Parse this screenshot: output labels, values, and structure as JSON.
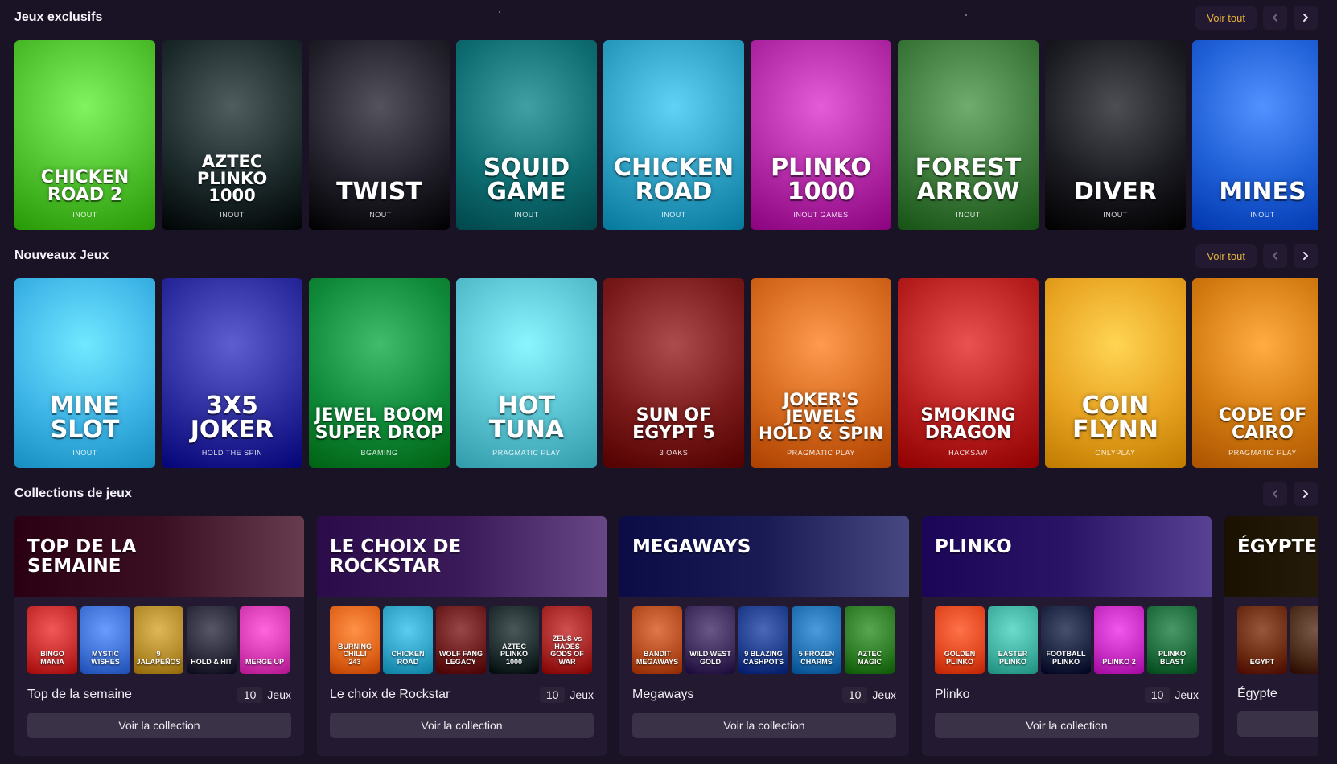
{
  "sections": {
    "exclusive": {
      "title": "Jeux exclusifs",
      "see_all": "Voir tout"
    },
    "new": {
      "title": "Nouveaux Jeux",
      "see_all": "Voir tout"
    },
    "collections": {
      "title": "Collections de jeux"
    }
  },
  "exclusive_games": [
    {
      "title": "CHICKEN ROAD 2",
      "provider": "INOUT",
      "bg": "#4fc12e"
    },
    {
      "title": "AZTEC\nPLINKO\n1000",
      "provider": "INOUT",
      "bg": "#1d2b2c"
    },
    {
      "title": "TWIST",
      "provider": "INOUT",
      "bg": "#22202a"
    },
    {
      "title": "SQUID\nGAME",
      "provider": "INOUT",
      "bg": "#0e6e72"
    },
    {
      "title": "CHICKEN ROAD",
      "provider": "INOUT",
      "bg": "#2ea0c4"
    },
    {
      "title": "PLINKO\n1000",
      "provider": "INOUT GAMES",
      "bg": "#b22aa6"
    },
    {
      "title": "FOREST\nARROW",
      "provider": "INOUT",
      "bg": "#3d7a3b"
    },
    {
      "title": "DIVER",
      "provider": "INOUT",
      "bg": "#1b1b22"
    },
    {
      "title": "MINES",
      "provider": "INOUT",
      "bg": "#1f5fd6"
    }
  ],
  "new_games": [
    {
      "title": "MINE SLOT",
      "provider": "INOUT",
      "bg": "#3fb6e8"
    },
    {
      "title": "3X5 JOKER",
      "provider": "HOLD THE SPIN",
      "bg": "#2c2c9e"
    },
    {
      "title": "JEWEL BOOM\nSUPER DROP",
      "provider": "BGAMING",
      "bg": "#0f8a3a"
    },
    {
      "title": "HOT\nTUNA",
      "provider": "PRAGMATIC PLAY",
      "bg": "#59c3d2"
    },
    {
      "title": "SUN OF\nEGYPT 5",
      "provider": "3 OAKS",
      "bg": "#7a1a1a"
    },
    {
      "title": "JOKER'S\nJEWELS\nHOLD & SPIN",
      "provider": "PRAGMATIC PLAY",
      "bg": "#d4681c"
    },
    {
      "title": "SMOKING\nDRAGON",
      "provider": "HACKSAW",
      "bg": "#b81f1f"
    },
    {
      "title": "COIN\nFLYNN",
      "provider": "ONLYPLAY",
      "bg": "#e8a321"
    },
    {
      "title": "CODE OF\nCAIRO",
      "provider": "PRAGMATIC PLAY",
      "bg": "#d27a10"
    }
  ],
  "collections": [
    {
      "banner_title": "TOP DE LA\nSEMAINE",
      "banner_bg": "#3a0f22",
      "name": "Top de la semaine",
      "count": "10",
      "count_label": "Jeux",
      "button": "Voir la collection",
      "thumbs": [
        {
          "label": "BINGO\nMANIA",
          "bg": "#c62b2b"
        },
        {
          "label": "MYSTIC\nWISHES",
          "bg": "#3d6fd4"
        },
        {
          "label": "9 JALAPEÑOS",
          "bg": "#b38a2a"
        },
        {
          "label": "HOLD & HIT",
          "bg": "#2a2a3a"
        },
        {
          "label": "MERGE UP",
          "bg": "#d438b0"
        }
      ]
    },
    {
      "banner_title": "LE CHOIX DE\nROCKSTAR",
      "banner_bg": "#3b1a5a",
      "name": "Le choix de Rockstar",
      "count": "10",
      "count_label": "Jeux",
      "button": "Voir la collection",
      "thumbs": [
        {
          "label": "BURNING CHILLI\n243",
          "bg": "#e0641a"
        },
        {
          "label": "CHICKEN ROAD",
          "bg": "#2ea0c4"
        },
        {
          "label": "WOLF FANG\nLEGACY",
          "bg": "#6a1a1a"
        },
        {
          "label": "AZTEC PLINKO\n1000",
          "bg": "#1d2b2c"
        },
        {
          "label": "ZEUS vs HADES\nGODS OF WAR",
          "bg": "#a32323"
        }
      ]
    },
    {
      "banner_title": "MEGAWAYS",
      "banner_bg": "#1a1a55",
      "name": "Megaways",
      "count": "10",
      "count_label": "Jeux",
      "button": "Voir la collection",
      "thumbs": [
        {
          "label": "BANDIT\nMEGAWAYS",
          "bg": "#b34a1d"
        },
        {
          "label": "WILD WEST\nGOLD",
          "bg": "#3c2a5a"
        },
        {
          "label": "9 BLAZING\nCASHPOTS",
          "bg": "#1d3b8a"
        },
        {
          "label": "5 FROZEN\nCHARMS",
          "bg": "#1f6fb0"
        },
        {
          "label": "AZTEC\nMAGIC",
          "bg": "#2d7a24"
        }
      ]
    },
    {
      "banner_title": "PLINKO",
      "banner_bg": "#2a1466",
      "name": "Plinko",
      "count": "10",
      "count_label": "Jeux",
      "button": "Voir la collection",
      "thumbs": [
        {
          "label": "GOLDEN\nPLINKO",
          "bg": "#e0451d"
        },
        {
          "label": "EASTER\nPLINKO",
          "bg": "#3fb0a0"
        },
        {
          "label": "FOOTBALL\nPLINKO",
          "bg": "#1a2440"
        },
        {
          "label": "PLINKO 2",
          "bg": "#c42ac0"
        },
        {
          "label": "PLINKO\nBLAST",
          "bg": "#1d6a3a"
        }
      ]
    },
    {
      "banner_title": "ÉGYPTE",
      "banner_bg": "#2a2010",
      "name": "Égypte",
      "count": "",
      "count_label": "",
      "button": "",
      "thumbs": [
        {
          "label": "EGYPT",
          "bg": "#6a2a10"
        },
        {
          "label": "",
          "bg": "#4a2a18"
        }
      ]
    }
  ],
  "colors": {
    "background": "#1a1326",
    "accent": "#e6b23a",
    "panel": "#231a31"
  },
  "icons": {
    "prev": "chevron-left-icon",
    "next": "chevron-right-icon"
  }
}
